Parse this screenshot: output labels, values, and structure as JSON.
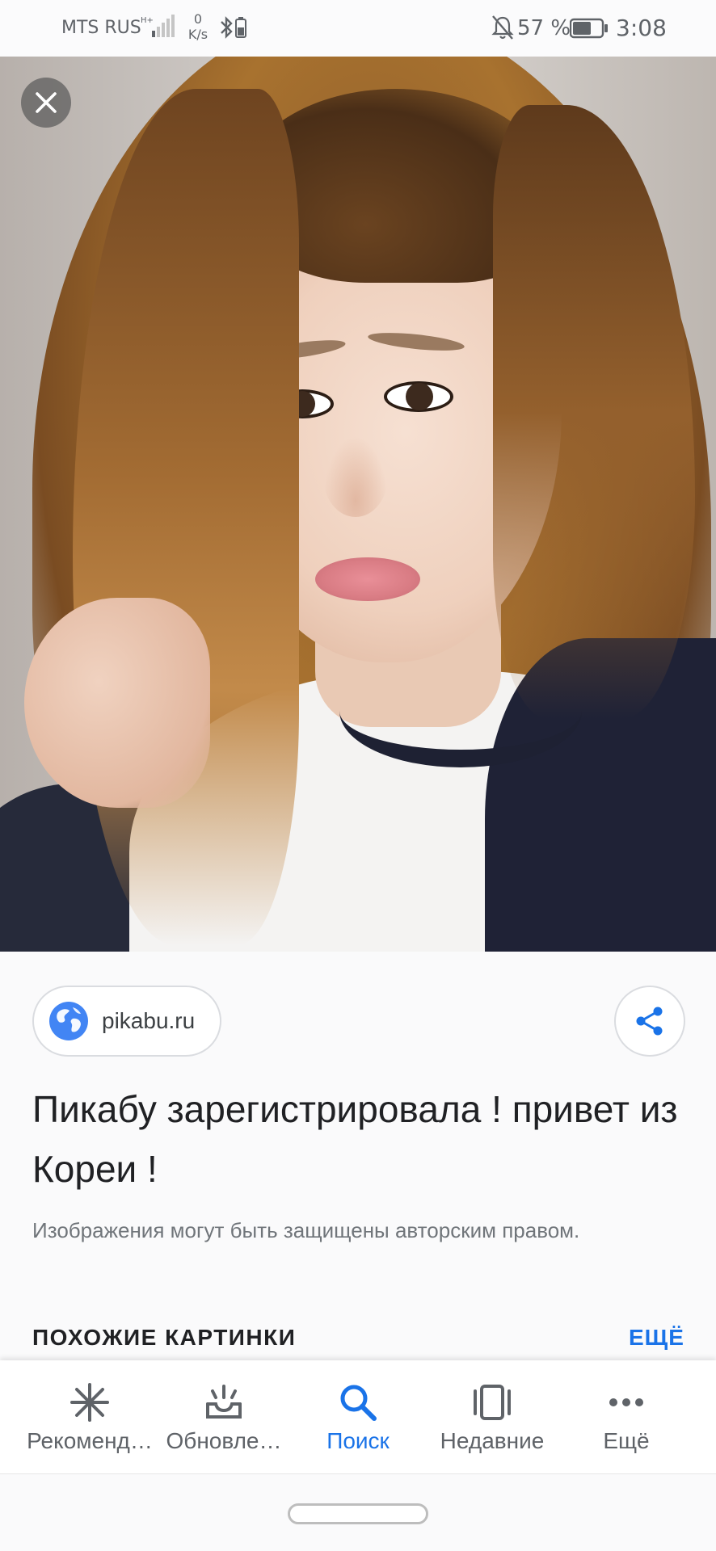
{
  "status_bar": {
    "carrier": "MTS RUS",
    "speed_value": "0",
    "speed_unit": "K/s",
    "battery_percent": "57 %",
    "time": "3:08"
  },
  "viewer": {
    "close_icon": "close-icon",
    "photo_description": "selfie-photo"
  },
  "source": {
    "label": "pikabu.ru",
    "icon": "globe-icon"
  },
  "share": {
    "icon": "share-icon"
  },
  "title": "Пикабу зарегистрировала ! привет из Кореи !",
  "copyright_notice": "Изображения могут быть защищены авторским правом.",
  "similar": {
    "header": "ПОХОЖИЕ КАРТИНКИ",
    "more": "ЕЩЁ"
  },
  "nav": {
    "items": [
      {
        "label": "Рекоменд…",
        "icon": "asterisk-icon",
        "active": false
      },
      {
        "label": "Обновле…",
        "icon": "updates-icon",
        "active": false
      },
      {
        "label": "Поиск",
        "icon": "search-icon",
        "active": true
      },
      {
        "label": "Недавние",
        "icon": "recent-cards-icon",
        "active": false
      },
      {
        "label": "Ещё",
        "icon": "more-dots-icon",
        "active": false
      }
    ]
  },
  "colors": {
    "accent": "#1a73e8",
    "text_primary": "#202124",
    "text_secondary": "#70757a"
  }
}
